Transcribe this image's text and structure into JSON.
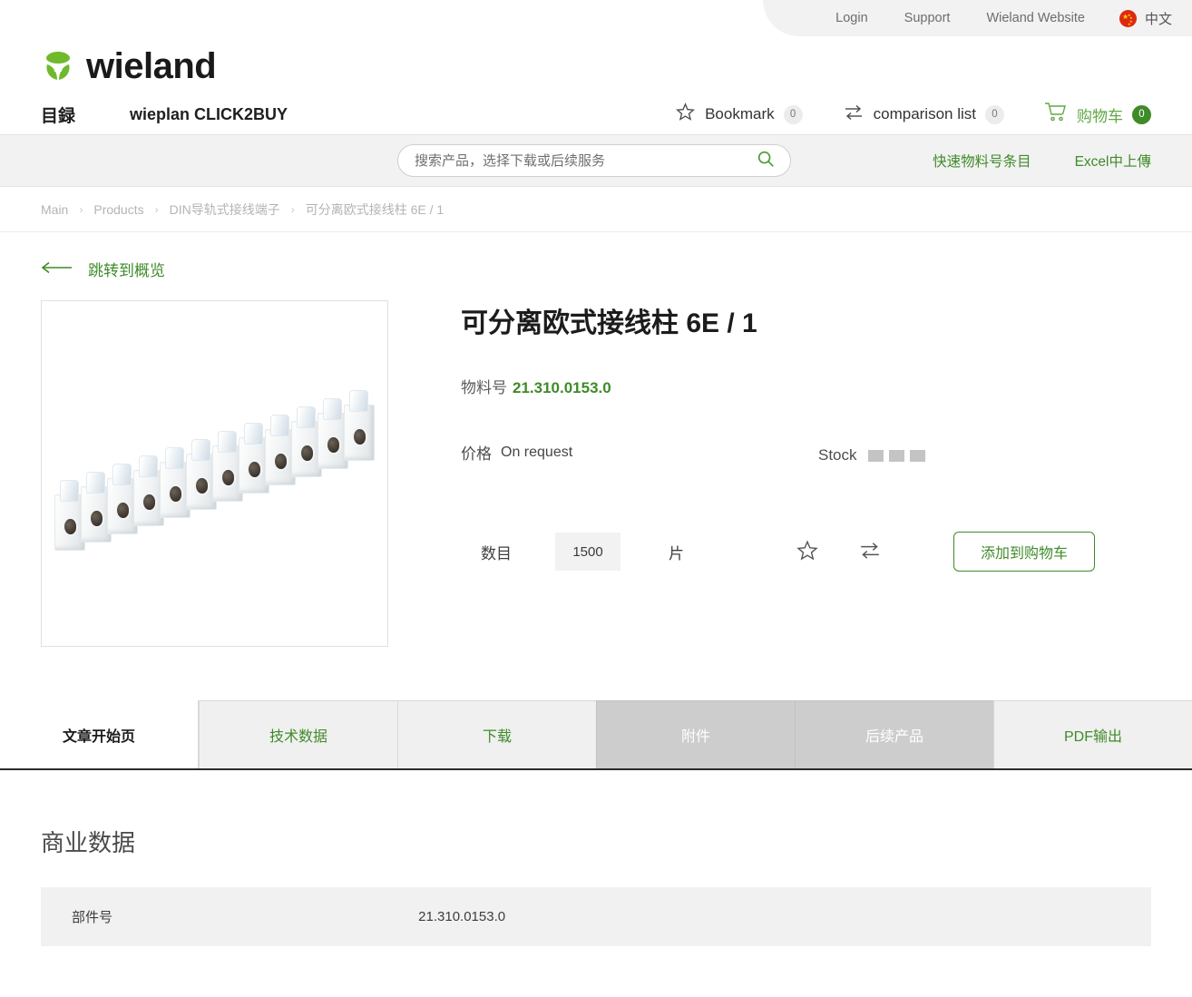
{
  "topbar": {
    "links": [
      {
        "label": "Login",
        "name": "login-link"
      },
      {
        "label": "Support",
        "name": "support-link"
      },
      {
        "label": "Wieland Website",
        "name": "wieland-website-link"
      }
    ],
    "language": {
      "label": "中文",
      "flag": "china-flag-icon"
    }
  },
  "header": {
    "brand": "wieland",
    "logo_icon": "wieland-leaf-logo",
    "nav": [
      {
        "label": "目録",
        "name": "nav-catalog"
      },
      {
        "label": "wieplan CLICK2BUY",
        "name": "nav-wieplan-click2buy"
      }
    ],
    "actions": {
      "bookmark": {
        "label": "Bookmark",
        "count": "0",
        "icon": "star-icon"
      },
      "comparison": {
        "label": "comparison list",
        "count": "0",
        "icon": "compare-arrows-icon"
      },
      "cart": {
        "label": "购物车",
        "count": "0",
        "icon": "shopping-cart-icon"
      }
    }
  },
  "search": {
    "placeholder": "搜索产品，选择下载或后续服务",
    "value": "",
    "icon": "search-icon",
    "links": [
      {
        "label": "快速物料号条目",
        "name": "quick-material-entry-link"
      },
      {
        "label": "Excel中上傳",
        "name": "excel-upload-link"
      }
    ]
  },
  "breadcrumb": {
    "items": [
      {
        "label": "Main",
        "current": false
      },
      {
        "label": "Products",
        "current": false
      },
      {
        "label": "DIN导轨式接线端子",
        "current": false
      },
      {
        "label": "可分离欧式接线柱 6E / 1",
        "current": true
      }
    ],
    "separator": "›"
  },
  "back_link": {
    "label": "跳转到概览",
    "icon": "arrow-left-icon"
  },
  "product": {
    "image_alt": "terminal-block-strip-photo",
    "title": "可分离欧式接线柱 6E / 1",
    "material_label": "物料号",
    "material_number": "21.310.0153.0",
    "price_label": "价格",
    "price_value": "On request",
    "stock_label": "Stock",
    "stock_bars": 3,
    "quantity_label": "数目",
    "quantity_value": "1500",
    "unit_label": "片",
    "bookmark_icon": "star-icon",
    "compare_icon": "compare-arrows-icon",
    "add_to_cart_label": "添加到购物车"
  },
  "tabs": [
    {
      "label": "文章开始页",
      "state": "active",
      "name": "tab-article-start-page"
    },
    {
      "label": "技术数据",
      "state": "enabled",
      "name": "tab-technical-data"
    },
    {
      "label": "下载",
      "state": "enabled",
      "name": "tab-downloads"
    },
    {
      "label": "附件",
      "state": "disabled",
      "name": "tab-accessories"
    },
    {
      "label": "后续产品",
      "state": "disabled",
      "name": "tab-successor-products"
    },
    {
      "label": "PDF输出",
      "state": "enabled",
      "name": "tab-pdf-output"
    }
  ],
  "commercial": {
    "section_title": "商业数据",
    "rows": [
      {
        "key": "部件号",
        "value": "21.310.0153.0"
      }
    ]
  },
  "colors": {
    "brand_green": "#3f8b29",
    "logo_green": "#6fb92c",
    "light_gray": "#f2f2f2",
    "disabled_gray": "#cdcdcd"
  }
}
